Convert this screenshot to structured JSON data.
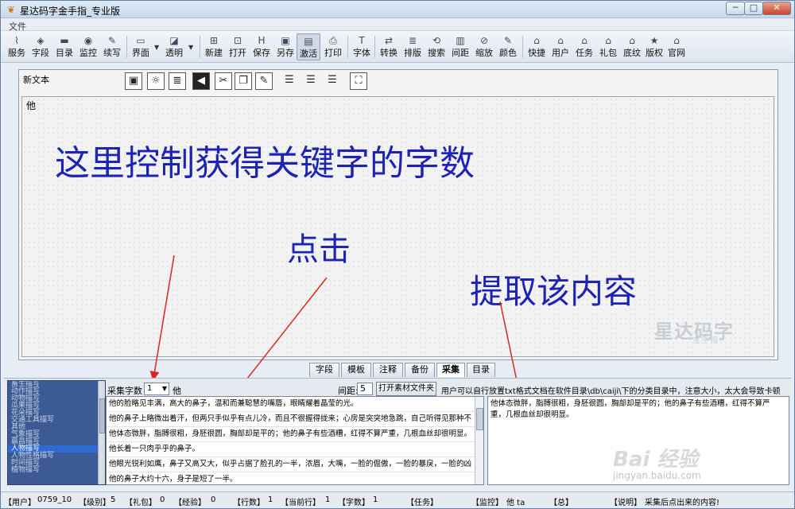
{
  "window": {
    "title": "星达码字金手指_专业版",
    "controls": {
      "min": "─",
      "max": "□",
      "close": "✕"
    }
  },
  "menu": {
    "file": "文件"
  },
  "toolbar": {
    "items": [
      {
        "label": "服务",
        "icon": "rss-icon",
        "glyph": "⌇"
      },
      {
        "label": "字段",
        "icon": "diamond-icon",
        "glyph": "◈"
      },
      {
        "label": "目录",
        "icon": "folder-icon",
        "glyph": "▬"
      },
      {
        "label": "监控",
        "icon": "monitor-icon",
        "glyph": "◉"
      },
      {
        "label": "续写",
        "icon": "pen-icon",
        "glyph": "✎"
      },
      {
        "label": "界面",
        "icon": "layout-icon",
        "glyph": "▭"
      },
      {
        "label": "透明",
        "icon": "transparency-icon",
        "glyph": "◪"
      },
      {
        "label": "新建",
        "icon": "new-icon",
        "glyph": "⊞"
      },
      {
        "label": "打开",
        "icon": "open-icon",
        "glyph": "⊡"
      },
      {
        "label": "保存",
        "icon": "save-icon",
        "glyph": "H"
      },
      {
        "label": "另存",
        "icon": "save-as-icon",
        "glyph": "▣"
      },
      {
        "label": "激活",
        "icon": "activate-icon",
        "glyph": "▤"
      },
      {
        "label": "打印",
        "icon": "print-icon",
        "glyph": "⎙"
      },
      {
        "label": "字体",
        "icon": "font-icon",
        "glyph": "T"
      },
      {
        "label": "转换",
        "icon": "convert-icon",
        "glyph": "⇄"
      },
      {
        "label": "排版",
        "icon": "typeset-icon",
        "glyph": "≣"
      },
      {
        "label": "搜索",
        "icon": "search-icon",
        "glyph": "⟲"
      },
      {
        "label": "间距",
        "icon": "spacing-icon",
        "glyph": "▥"
      },
      {
        "label": "缩放",
        "icon": "zoom-icon",
        "glyph": "⊘"
      },
      {
        "label": "颜色",
        "icon": "color-icon",
        "glyph": "✎"
      },
      {
        "label": "快捷",
        "icon": "shortcut-icon",
        "glyph": "⌂"
      },
      {
        "label": "用户",
        "icon": "user-icon",
        "glyph": "⌂"
      },
      {
        "label": "任务",
        "icon": "task-icon",
        "glyph": "⌂"
      },
      {
        "label": "礼包",
        "icon": "gift-icon",
        "glyph": "⌂"
      },
      {
        "label": "底纹",
        "icon": "shading-icon",
        "glyph": "⌂"
      },
      {
        "label": "版权",
        "icon": "copyright-icon",
        "glyph": "★"
      },
      {
        "label": "官网",
        "icon": "website-icon",
        "glyph": "⌂"
      }
    ]
  },
  "document": {
    "label": "新文本",
    "content": "他"
  },
  "annotations": {
    "a1": "这里控制获得关键字的字数",
    "a2": "点击",
    "a3": "提取该内容"
  },
  "watermark": {
    "brand": "星达码字",
    "sub": "金手指"
  },
  "tabs": [
    {
      "label": "字段"
    },
    {
      "label": "模板"
    },
    {
      "label": "注释"
    },
    {
      "label": "备份"
    },
    {
      "label": "采集"
    },
    {
      "label": "目录"
    }
  ],
  "collect": {
    "count_label": "采集字数",
    "count_value": "1",
    "keyword": "他",
    "gap_label": "间距:",
    "gap_value": "5",
    "open_button": "打开素材文件夹",
    "hint": "用户可以自行放置txt格式文档在软件目录\\db\\caiji\\下的分类目录中，注意大小，太大会导致卡顿"
  },
  "categories": [
    "畜生描写",
    "动作描写",
    "动物描写",
    "瓜果描写",
    "花朵描写",
    "交通工具描写",
    "其他",
    "气象描写",
    "赢昌描写",
    "人物描写",
    "人物性格描写",
    "时间描写",
    "植物描写"
  ],
  "selected_category": "人物描写",
  "source_lines": [
    "他的脸略见丰满，高大的鼻子，温和而兼聪慧的嘴唇，眼睛耀着晶莹的光。",
    "他的鼻子上略微出着汗，但两只手似乎有点儿冷，而且不很握得拢来；心房是突突地急跳，自己听得见那种不",
    "他体态微胖，脂膊很粗，身胚很圆，胸部却是平的；他的鼻子有些酒糟，红得不算严重，几根血丝却很明显。",
    "他长着一只肉乎乎的鼻子。",
    "他眼光锐利如鹰，鼻子又高又大，似乎占据了脸孔的一半，浓眉，大嘴，一脸的倔傲，一脸的暴戾，一脸的凶",
    "他的鼻子大约十六，身子是短了一半。"
  ],
  "result_text": "他体态微胖，脂膊很粗，身胚很圆，胸部却是平的；他的鼻子有些酒糟，红得不算严重，几根血丝却很明显。",
  "status": {
    "user_label": "【用户】",
    "user": "0759_10",
    "level_label": "【级别】",
    "level": "5",
    "gift_label": "【礼包】",
    "gift": "0",
    "exp_label": "【经验】",
    "exp": "0",
    "lines_label": "【行数】",
    "lines": "1",
    "curline_label": "【当前行】",
    "curline": "1",
    "chars_label": "【字数】",
    "chars": "1",
    "task_label": "【任务】",
    "monitor_label": "【监控】",
    "monitor": "他 ta",
    "total_label": "【总】",
    "note_label": "【说明】",
    "note": "采集后点出来的内容!"
  },
  "site_watermark": {
    "brand": "Bai 经验",
    "url": "jingyan.baidu.com"
  }
}
